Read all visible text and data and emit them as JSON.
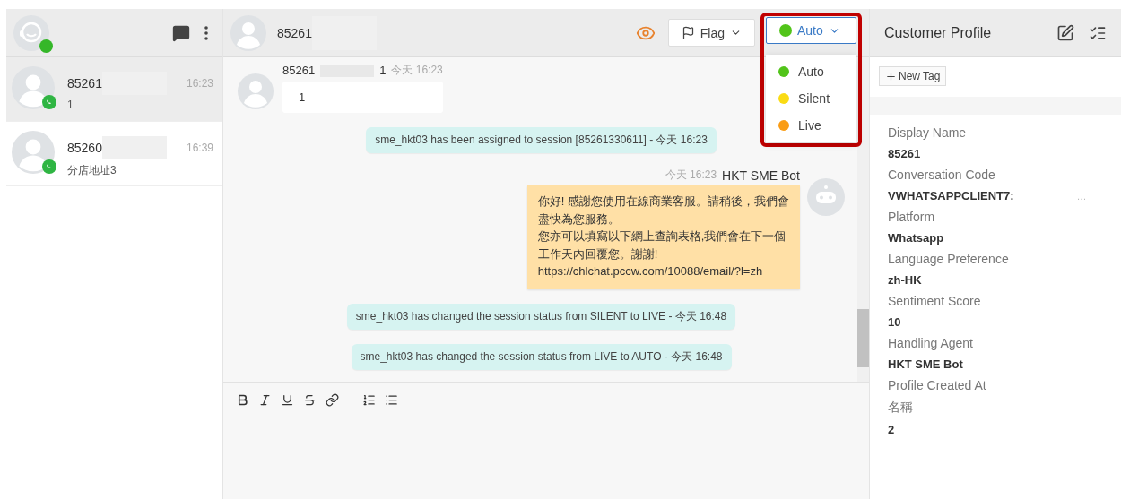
{
  "agent": {
    "online": true
  },
  "conversations": [
    {
      "name": "85261",
      "time": "16:23",
      "preview": "1",
      "selected": true,
      "redacted": true
    },
    {
      "name": "85260",
      "time": "16:39",
      "preview": "分店地址3",
      "selected": false,
      "redacted": true
    }
  ],
  "chat_header": {
    "name": "85261",
    "redacted": true,
    "flag_label": "Flag",
    "status": {
      "label": "Auto",
      "color": "#52c41a"
    }
  },
  "status_menu": {
    "open": true,
    "highlighted": true,
    "options": [
      {
        "label": "Auto",
        "color": "#52c41a"
      },
      {
        "label": "Silent",
        "color": "#fadb14"
      },
      {
        "label": "Live",
        "color": "#fa9c14"
      }
    ]
  },
  "messages": [
    {
      "kind": "incoming",
      "sender": "85261",
      "sender_suffix": "1",
      "time": "今天 16:23",
      "text": "1"
    },
    {
      "kind": "system",
      "text": "sme_hkt03 has been assigned to session [85261330611] - 今天 16:23"
    },
    {
      "kind": "bot",
      "time": "今天 16:23",
      "sender": "HKT SME Bot",
      "lines": [
        "你好! 感謝您使用在線商業客服。請稍後，我們會",
        "盡快為您服務。",
        "您亦可以填寫以下網上查詢表格,我們會在下一個",
        "工作天內回覆您。謝謝!",
        "https://chlchat.pccw.com/10088/email/?l=zh"
      ]
    },
    {
      "kind": "system",
      "text": "sme_hkt03 has changed the session status from SILENT to LIVE - 今天 16:48"
    },
    {
      "kind": "system",
      "text": "sme_hkt03 has changed the session status from LIVE to AUTO - 今天 16:48"
    }
  ],
  "profile": {
    "title": "Customer Profile",
    "new_tag": "New Tag",
    "fields": [
      {
        "label": "Display Name",
        "value": "85261"
      },
      {
        "label": "Conversation Code",
        "value": "VWHATSAPPCLIENT7:",
        "suffix": "…"
      },
      {
        "label": "Platform",
        "value": "Whatsapp"
      },
      {
        "label": "Language Preference",
        "value": "zh-HK"
      },
      {
        "label": "Sentiment Score",
        "value": "10"
      },
      {
        "label": "Handling Agent",
        "value": "HKT SME Bot"
      },
      {
        "label": "Profile Created At"
      },
      {
        "label": "名稱",
        "value": "2"
      }
    ]
  }
}
